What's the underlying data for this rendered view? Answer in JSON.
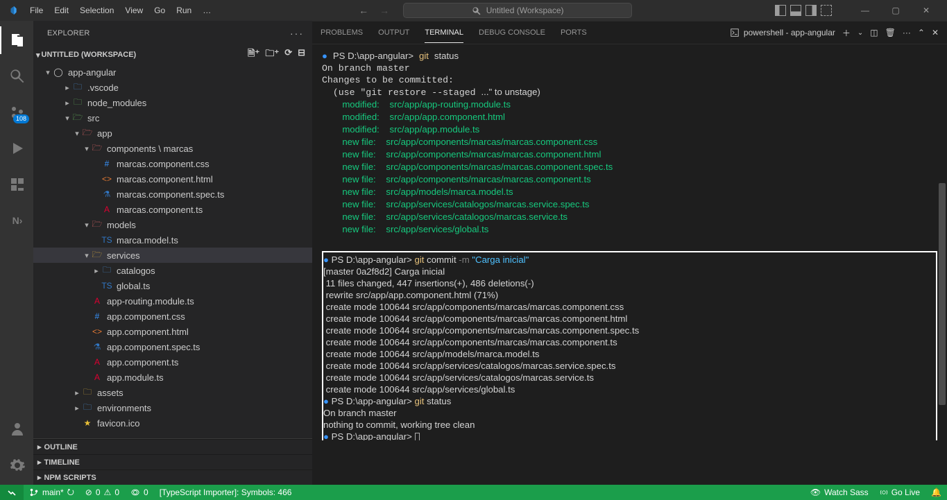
{
  "title_search": "Untitled (Workspace)",
  "menu": [
    "File",
    "Edit",
    "Selection",
    "View",
    "Go",
    "Run",
    "…"
  ],
  "activity_badge_scm": "108",
  "explorer": {
    "title": "EXPLORER",
    "workspace": "UNTITLED (WORKSPACE)",
    "root": "app-angular",
    "children": [
      {
        "name": ".vscode",
        "icon": "folder-blue",
        "twist": "right",
        "indent": 2,
        "chev": true
      },
      {
        "name": "node_modules",
        "icon": "folder-green",
        "twist": "right",
        "indent": 2,
        "chev": true
      },
      {
        "name": "src",
        "icon": "folder-green",
        "twist": "down",
        "indent": 2,
        "chev": true
      },
      {
        "name": "app",
        "icon": "folder-red",
        "twist": "down",
        "indent": 3,
        "chev": true
      },
      {
        "name": "components \\ marcas",
        "icon": "folder-red",
        "twist": "down",
        "indent": 4,
        "chev": true
      },
      {
        "name": "marcas.component.css",
        "icon": "ic-css",
        "glyph": "#",
        "indent": 5
      },
      {
        "name": "marcas.component.html",
        "icon": "ic-html",
        "glyph": "<>",
        "indent": 5
      },
      {
        "name": "marcas.component.spec.ts",
        "icon": "ic-ts",
        "glyph": "⚗",
        "indent": 5
      },
      {
        "name": "marcas.component.ts",
        "icon": "ic-ang",
        "glyph": "A",
        "indent": 5
      },
      {
        "name": "models",
        "icon": "folder-red",
        "twist": "down",
        "indent": 4,
        "chev": true
      },
      {
        "name": "marca.model.ts",
        "icon": "ic-ts",
        "glyph": "TS",
        "indent": 5
      },
      {
        "name": "services",
        "icon": "folder-gold",
        "twist": "down",
        "indent": 4,
        "chev": true,
        "selected": true
      },
      {
        "name": "catalogos",
        "icon": "folder-blue",
        "twist": "right",
        "indent": 5,
        "chev": true
      },
      {
        "name": "global.ts",
        "icon": "ic-ts",
        "glyph": "TS",
        "indent": 5
      },
      {
        "name": "app-routing.module.ts",
        "icon": "ic-ang",
        "glyph": "A",
        "indent": 4
      },
      {
        "name": "app.component.css",
        "icon": "ic-css",
        "glyph": "#",
        "indent": 4
      },
      {
        "name": "app.component.html",
        "icon": "ic-html",
        "glyph": "<>",
        "indent": 4
      },
      {
        "name": "app.component.spec.ts",
        "icon": "ic-ts",
        "glyph": "⚗",
        "indent": 4
      },
      {
        "name": "app.component.ts",
        "icon": "ic-ang",
        "glyph": "A",
        "indent": 4
      },
      {
        "name": "app.module.ts",
        "icon": "ic-ang",
        "glyph": "A",
        "indent": 4
      },
      {
        "name": "assets",
        "icon": "folder-gold",
        "twist": "right",
        "indent": 3,
        "chev": true
      },
      {
        "name": "environments",
        "icon": "folder-blue",
        "twist": "right",
        "indent": 3,
        "chev": true
      },
      {
        "name": "favicon.ico",
        "icon": "ic-star",
        "glyph": "★",
        "indent": 3
      }
    ],
    "sections": [
      "OUTLINE",
      "TIMELINE",
      "NPM SCRIPTS"
    ]
  },
  "panel": {
    "tabs": [
      "PROBLEMS",
      "OUTPUT",
      "TERMINAL",
      "DEBUG CONSOLE",
      "PORTS"
    ],
    "active": "TERMINAL",
    "shell": "powershell - app-angular"
  },
  "terminal": {
    "prompt": "PS D:\\app-angular>",
    "blocks": [
      {
        "type": "cmd",
        "text": "git status",
        "yellow": "git",
        "rest": "status"
      },
      {
        "type": "line",
        "text": "On branch master"
      },
      {
        "type": "line",
        "text": "Changes to be committed:"
      },
      {
        "type": "line",
        "text": "  (use \"git restore --staged <file>...\" to unstage)"
      },
      {
        "type": "staged",
        "label": "modified:",
        "path": "src/app/app-routing.module.ts"
      },
      {
        "type": "staged",
        "label": "modified:",
        "path": "src/app/app.component.html"
      },
      {
        "type": "staged",
        "label": "modified:",
        "path": "src/app/app.module.ts"
      },
      {
        "type": "staged",
        "label": "new file:",
        "path": "src/app/components/marcas/marcas.component.css"
      },
      {
        "type": "staged",
        "label": "new file:",
        "path": "src/app/components/marcas/marcas.component.html"
      },
      {
        "type": "staged",
        "label": "new file:",
        "path": "src/app/components/marcas/marcas.component.spec.ts"
      },
      {
        "type": "staged",
        "label": "new file:",
        "path": "src/app/components/marcas/marcas.component.ts"
      },
      {
        "type": "staged",
        "label": "new file:",
        "path": "src/app/models/marca.model.ts"
      },
      {
        "type": "staged",
        "label": "new file:",
        "path": "src/app/services/catalogos/marcas.service.spec.ts"
      },
      {
        "type": "staged",
        "label": "new file:",
        "path": "src/app/services/catalogos/marcas.service.ts"
      },
      {
        "type": "staged",
        "label": "new file:",
        "path": "src/app/services/global.ts"
      }
    ],
    "highlight": {
      "cmd": {
        "yellow": "git",
        "rest": "commit",
        "dash": "-m",
        "str": "\"Carga inicial\""
      },
      "lines": [
        "[master 0a2f8d2] Carga inicial",
        " 11 files changed, 447 insertions(+), 486 deletions(-)",
        " rewrite src/app/app.component.html (71%)",
        " create mode 100644 src/app/components/marcas/marcas.component.css",
        " create mode 100644 src/app/components/marcas/marcas.component.html",
        " create mode 100644 src/app/components/marcas/marcas.component.spec.ts",
        " create mode 100644 src/app/components/marcas/marcas.component.ts",
        " create mode 100644 src/app/models/marca.model.ts",
        " create mode 100644 src/app/services/catalogos/marcas.service.spec.ts",
        " create mode 100644 src/app/services/catalogos/marcas.service.ts",
        " create mode 100644 src/app/services/global.ts"
      ],
      "after": [
        {
          "type": "cmd",
          "yellow": "git",
          "rest": "status"
        },
        {
          "type": "line",
          "text": "On branch master"
        },
        {
          "type": "line",
          "text": "nothing to commit, working tree clean"
        },
        {
          "type": "prompt"
        }
      ]
    }
  },
  "status": {
    "branch": "main*",
    "sync": "⭮",
    "errors": "0",
    "warnings": "0",
    "ports": "0",
    "task": "[TypeScript Importer]: Symbols: 466",
    "right": [
      "Watch Sass",
      "Go Live"
    ]
  }
}
